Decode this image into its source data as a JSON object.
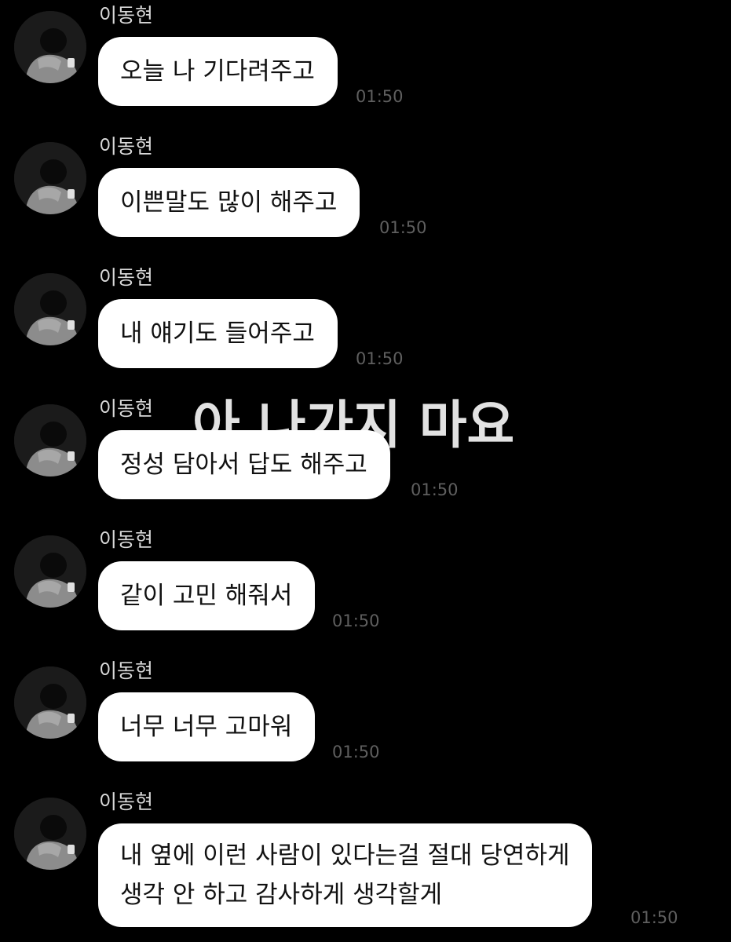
{
  "overlay_caption": "아 나가지 마요",
  "colors": {
    "background": "#000000",
    "bubble": "#ffffff",
    "sender_name": "#d9d9d9",
    "timestamp": "#5f5f5f"
  },
  "messages": [
    {
      "sender": "이동현",
      "lines": [
        "오늘 나 기다려주고"
      ],
      "time": "01:50"
    },
    {
      "sender": "이동현",
      "lines": [
        "이쁜말도 많이 해주고"
      ],
      "time": "01:50"
    },
    {
      "sender": "이동현",
      "lines": [
        "내 얘기도 들어주고"
      ],
      "time": "01:50"
    },
    {
      "sender": "이동현",
      "lines": [
        "정성 담아서 답도 해주고"
      ],
      "time": "01:50"
    },
    {
      "sender": "이동현",
      "lines": [
        "같이 고민 해줘서"
      ],
      "time": "01:50"
    },
    {
      "sender": "이동현",
      "lines": [
        "너무 너무 고마워"
      ],
      "time": "01:50"
    },
    {
      "sender": "이동현",
      "lines": [
        "내 옆에 이런 사람이 있다는걸 절대 당연하게",
        "생각 안 하고 감사하게 생각할게"
      ],
      "time": "01:50"
    }
  ]
}
